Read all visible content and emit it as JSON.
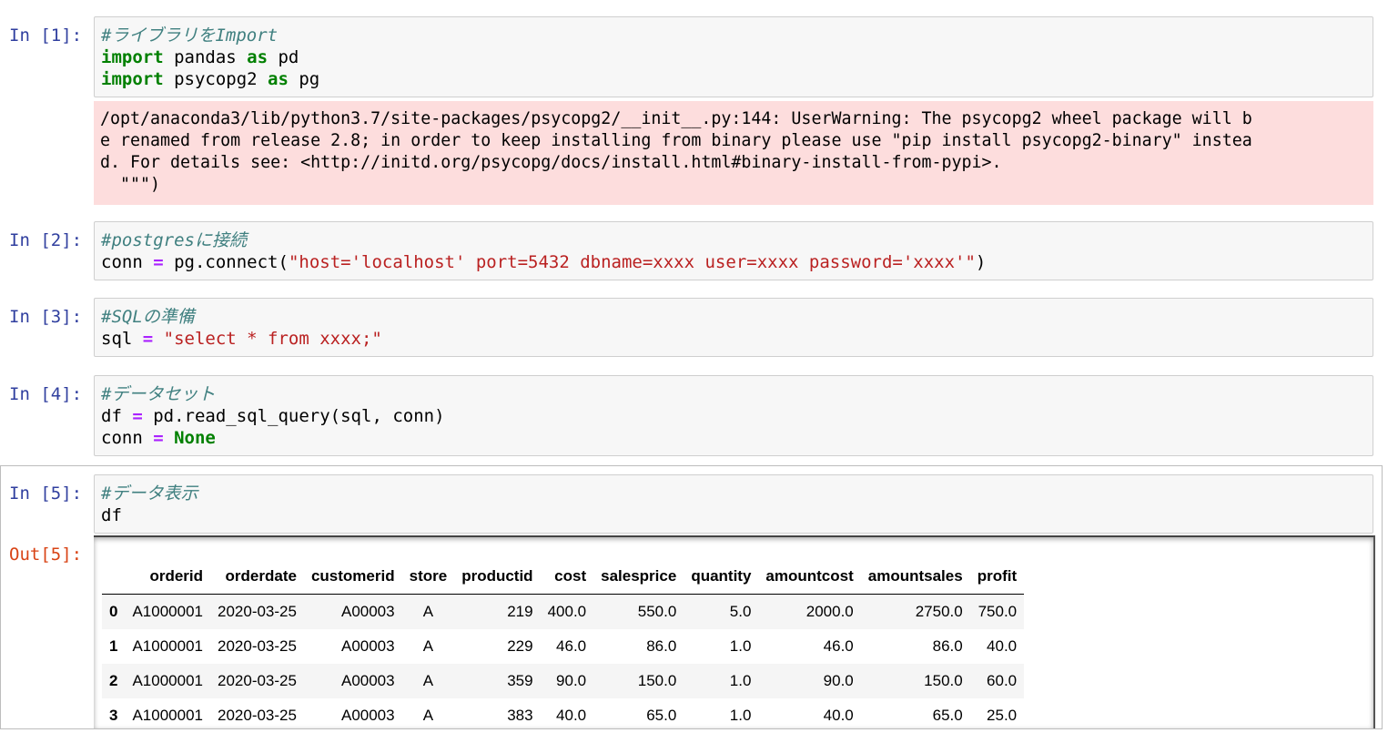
{
  "cells": [
    {
      "prompt": "In [1]:",
      "code": [
        {
          "comment": "#ライブラリをImport"
        },
        {
          "kw": "import",
          "a": " pandas ",
          "kw2": "as",
          "b": " pd"
        },
        {
          "kw": "import",
          "a": " psycopg2 ",
          "kw2": "as",
          "b": " pg"
        }
      ],
      "stderr": [
        "/opt/anaconda3/lib/python3.7/site-packages/psycopg2/__init__.py:144: UserWarning: The psycopg2 wheel package will b",
        "e renamed from release 2.8; in order to keep installing from binary please use \"pip install psycopg2-binary\" instea",
        "d. For details see: <http://initd.org/psycopg/docs/install.html#binary-install-from-pypi>.",
        "  \"\"\")"
      ]
    },
    {
      "prompt": "In [2]:",
      "comment": "#postgresに接続",
      "var": "conn ",
      "op": "=",
      "call": " pg.connect(",
      "str": "\"host='localhost' port=5432 dbname=xxxx user=xxxx password='xxxx'\"",
      "close": ")"
    },
    {
      "prompt": "In [3]:",
      "comment": "#SQLの準備",
      "var": "sql ",
      "op": "=",
      "str": " \"select * from xxxx;\""
    },
    {
      "prompt": "In [4]:",
      "comment": "#データセット",
      "var": "df ",
      "op": "=",
      "call": " pd.read_sql_query(sql, conn)",
      "var2": "conn ",
      "op2": "=",
      "kw": " None"
    },
    {
      "prompt": "In [5]:",
      "comment": "#データ表示",
      "code": "df",
      "out_prompt": "Out[5]:"
    }
  ],
  "table": {
    "columns": [
      "",
      "orderid",
      "orderdate",
      "customerid",
      "store",
      "productid",
      "cost",
      "salesprice",
      "quantity",
      "amountcost",
      "amountsales",
      "profit"
    ],
    "rows": [
      [
        "0",
        "A1000001",
        "2020-03-25",
        "A00003",
        "A",
        "219",
        "400.0",
        "550.0",
        "5.0",
        "2000.0",
        "2750.0",
        "750.0"
      ],
      [
        "1",
        "A1000001",
        "2020-03-25",
        "A00003",
        "A",
        "229",
        "46.0",
        "86.0",
        "1.0",
        "46.0",
        "86.0",
        "40.0"
      ],
      [
        "2",
        "A1000001",
        "2020-03-25",
        "A00003",
        "A",
        "359",
        "90.0",
        "150.0",
        "1.0",
        "90.0",
        "150.0",
        "60.0"
      ],
      [
        "3",
        "A1000001",
        "2020-03-25",
        "A00003",
        "A",
        "383",
        "40.0",
        "65.0",
        "1.0",
        "40.0",
        "65.0",
        "25.0"
      ]
    ]
  }
}
